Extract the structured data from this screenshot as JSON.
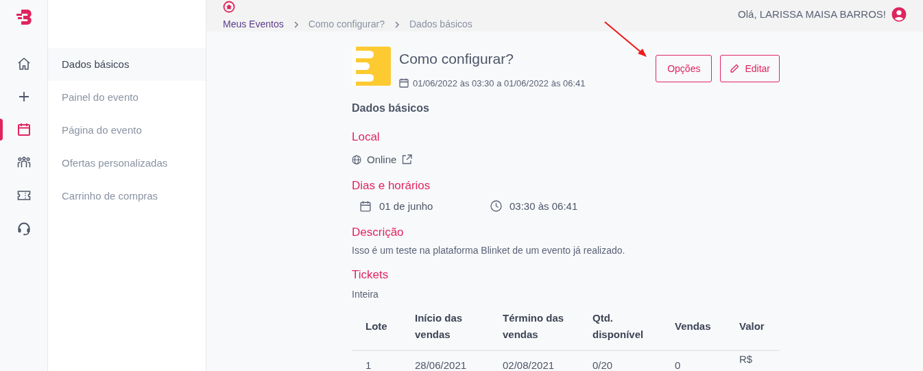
{
  "rail": {
    "items": [
      {
        "kind": "home",
        "selected": false
      },
      {
        "kind": "plus",
        "selected": false
      },
      {
        "kind": "calendar",
        "selected": true
      },
      {
        "kind": "people",
        "selected": false
      },
      {
        "kind": "ticket",
        "selected": false
      },
      {
        "kind": "headset",
        "selected": false
      }
    ]
  },
  "submenu": {
    "items": [
      {
        "label": "Dados básicos",
        "selected": true
      },
      {
        "label": "Painel do evento",
        "selected": false
      },
      {
        "label": "Página do evento",
        "selected": false
      },
      {
        "label": "Ofertas personalizadas",
        "selected": false
      },
      {
        "label": "Carrinho de compras",
        "selected": false
      }
    ]
  },
  "breadcrumb": [
    "Meus Eventos",
    "Como configurar?",
    "Dados básicos"
  ],
  "greeting": "Olá, LARISSA MAISA BARROS!",
  "event": {
    "title": "Como configurar?",
    "period": "01/06/2022 às 03:30 a 01/06/2022 às 06:41"
  },
  "buttons": [
    {
      "kind": "options",
      "label": "Opções"
    },
    {
      "kind": "edit",
      "label": "Editar"
    }
  ],
  "section_title": "Dados básicos",
  "local": {
    "heading": "Local",
    "value": "Online"
  },
  "schedule": {
    "heading": "Dias e horários",
    "date": "01 de junho",
    "time": "03:30 às 06:41"
  },
  "description": {
    "heading": "Descrição",
    "text": "Isso é um teste na plataforma Blinket de um evento já realizado."
  },
  "tickets": {
    "heading": "Tickets",
    "name": "Inteira",
    "table": {
      "columns": [
        "Lote",
        "Início das vendas",
        "Término das vendas",
        "Qtd. disponível",
        "Vendas",
        "Valor"
      ],
      "rows": [
        [
          "1",
          "28/06/2021",
          "02/08/2021",
          "0/20",
          "0",
          "R$"
        ]
      ]
    }
  }
}
